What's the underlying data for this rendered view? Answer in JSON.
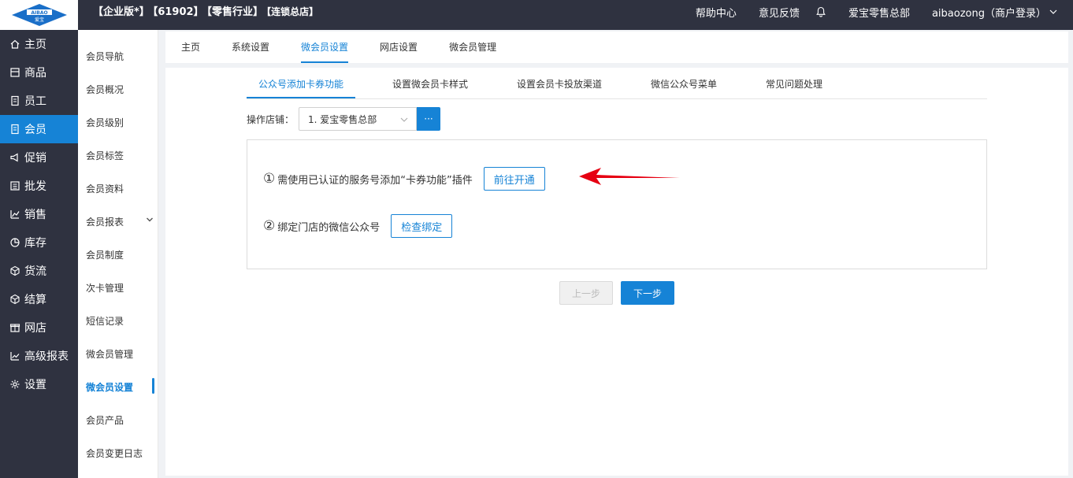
{
  "topbar": {
    "logo_text": "AIBAO",
    "logo_sub": "爱宝",
    "title_parts": [
      "【企业版*】",
      "【61902】",
      "【零售行业】",
      "【连锁总店】"
    ],
    "help": "帮助中心",
    "feedback": "意见反馈",
    "store_name": "爱宝零售总部",
    "user": "aibaozong（商户登录）"
  },
  "sidebar": {
    "items": [
      {
        "label": "主页",
        "icon": "home-icon"
      },
      {
        "label": "商品",
        "icon": "goods-icon"
      },
      {
        "label": "员工",
        "icon": "staff-icon"
      },
      {
        "label": "会员",
        "icon": "member-icon",
        "active": true
      },
      {
        "label": "促销",
        "icon": "promotion-icon"
      },
      {
        "label": "批发",
        "icon": "wholesale-icon"
      },
      {
        "label": "销售",
        "icon": "sales-icon"
      },
      {
        "label": "库存",
        "icon": "stock-icon"
      },
      {
        "label": "货流",
        "icon": "logistics-icon"
      },
      {
        "label": "结算",
        "icon": "settle-icon"
      },
      {
        "label": "网店",
        "icon": "shop-icon"
      },
      {
        "label": "高级报表",
        "icon": "report-icon"
      },
      {
        "label": "设置",
        "icon": "settings-icon"
      }
    ]
  },
  "subside": {
    "items": [
      "会员导航",
      "会员概况",
      "会员级别",
      "会员标签",
      "会员资料",
      "会员报表",
      "会员制度",
      "次卡管理",
      "短信记录",
      "微会员管理",
      "微会员设置",
      "会员产品",
      "会员变更日志"
    ],
    "active_index": 10
  },
  "tabs": [
    "主页",
    "系统设置",
    "微会员设置",
    "网店设置",
    "微会员管理"
  ],
  "active_tab": 2,
  "steps": [
    "公众号添加卡券功能",
    "设置微会员卡样式",
    "设置会员卡投放渠道",
    "微信公众号菜单",
    "常见问题处理"
  ],
  "store": {
    "label": "操作店铺：",
    "value": "1. 爱宝零售总部",
    "more": "···"
  },
  "instructions": {
    "line1_num": "①",
    "line1_text": "需使用已认证的服务号添加“卡券功能”插件",
    "line1_btn": "前往开通",
    "line2_num": "②",
    "line2_text": "绑定门店的微信公众号",
    "line2_btn": "检查绑定"
  },
  "nav": {
    "prev": "上一步",
    "next": "下一步"
  },
  "colors": {
    "accent": "#1683d6",
    "dark": "#2f3240",
    "arrow": "#e60012"
  }
}
